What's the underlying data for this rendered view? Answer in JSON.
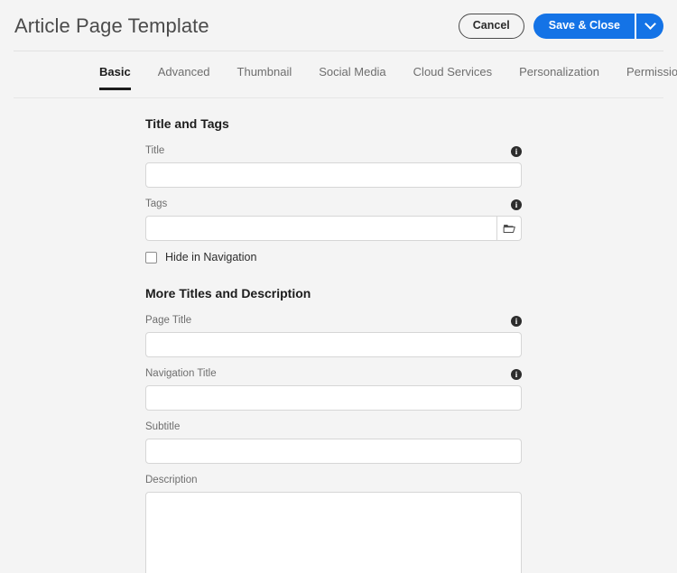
{
  "header": {
    "title": "Article Page Template",
    "cancel_label": "Cancel",
    "save_label": "Save & Close",
    "save_more_icon": "chevron-down-icon"
  },
  "tabs": [
    {
      "label": "Basic",
      "active": true
    },
    {
      "label": "Advanced",
      "active": false
    },
    {
      "label": "Thumbnail",
      "active": false
    },
    {
      "label": "Social Media",
      "active": false
    },
    {
      "label": "Cloud Services",
      "active": false
    },
    {
      "label": "Personalization",
      "active": false
    },
    {
      "label": "Permissions",
      "active": false
    }
  ],
  "form": {
    "sections": [
      {
        "heading": "Title and Tags",
        "fields": [
          {
            "label": "Title",
            "value": "",
            "placeholder": "",
            "info": true,
            "type": "text"
          },
          {
            "label": "Tags",
            "value": "",
            "placeholder": "",
            "info": true,
            "type": "text-with-picker",
            "picker_icon": "folder-icon"
          }
        ],
        "checkbox": {
          "label": "Hide in Navigation",
          "checked": false
        }
      },
      {
        "heading": "More Titles and Description",
        "fields": [
          {
            "label": "Page Title",
            "value": "",
            "placeholder": "",
            "info": true,
            "type": "text"
          },
          {
            "label": "Navigation Title",
            "value": "",
            "placeholder": "",
            "info": true,
            "type": "text"
          },
          {
            "label": "Subtitle",
            "value": "",
            "placeholder": "",
            "info": false,
            "type": "text"
          },
          {
            "label": "Description",
            "value": "",
            "placeholder": "",
            "info": false,
            "type": "textarea"
          }
        ]
      }
    ],
    "info_glyph": "i"
  },
  "colors": {
    "accent": "#1473e6",
    "page_background": "#f4f4f4",
    "text_primary": "#1c1c1c",
    "text_secondary": "#6e6e6e",
    "border": "#d6d6d6"
  }
}
